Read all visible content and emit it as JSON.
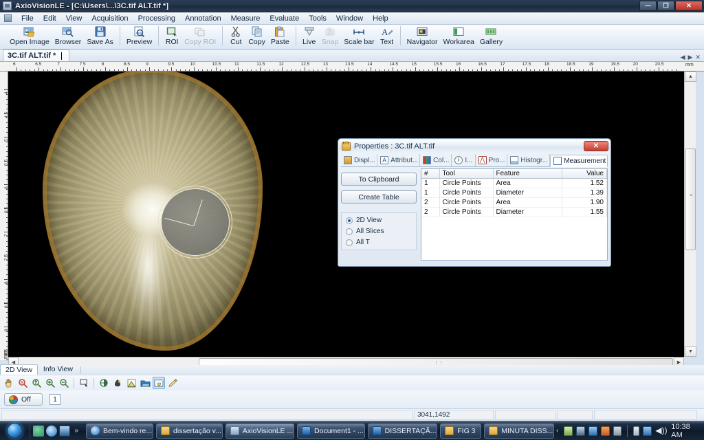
{
  "window": {
    "title": "AxioVisionLE - [C:\\Users\\...\\3C.tif ALT.tif *]",
    "minimize_label": "—",
    "restore_label": "❐",
    "close_label": "✕"
  },
  "menubar": {
    "items": [
      {
        "label": "File"
      },
      {
        "label": "Edit"
      },
      {
        "label": "View"
      },
      {
        "label": "Acquisition"
      },
      {
        "label": "Processing"
      },
      {
        "label": "Annotation"
      },
      {
        "label": "Measure"
      },
      {
        "label": "Evaluate"
      },
      {
        "label": "Tools"
      },
      {
        "label": "Window"
      },
      {
        "label": "Help"
      }
    ]
  },
  "toolbar": {
    "items": [
      {
        "label": "Open Image",
        "icon": "open-image-icon",
        "disabled": false
      },
      {
        "label": "Browser",
        "icon": "browser-icon",
        "disabled": false
      },
      {
        "label": "Save As",
        "icon": "save-as-icon",
        "disabled": false
      },
      {
        "label": "Preview",
        "icon": "preview-icon",
        "disabled": false
      },
      {
        "label": "ROI",
        "icon": "roi-icon",
        "disabled": false
      },
      {
        "label": "Copy ROI",
        "icon": "copy-roi-icon",
        "disabled": true
      },
      {
        "label": "Cut",
        "icon": "cut-icon",
        "disabled": false
      },
      {
        "label": "Copy",
        "icon": "copy-icon",
        "disabled": false
      },
      {
        "label": "Paste",
        "icon": "paste-icon",
        "disabled": false
      },
      {
        "label": "Live",
        "icon": "live-icon",
        "disabled": false
      },
      {
        "label": "Snap",
        "icon": "snap-icon",
        "disabled": true
      },
      {
        "label": "Scale bar",
        "icon": "scale-bar-icon",
        "disabled": false
      },
      {
        "label": "Text",
        "icon": "text-icon",
        "disabled": false
      },
      {
        "label": "Navigator",
        "icon": "navigator-icon",
        "disabled": false
      },
      {
        "label": "Workarea",
        "icon": "workarea-icon",
        "disabled": false
      },
      {
        "label": "Gallery",
        "icon": "gallery-icon",
        "disabled": false
      }
    ]
  },
  "document_tab": {
    "label": "3C.tif ALT.tif *",
    "nav_prev": "◀",
    "nav_next": "▶",
    "close": "✕"
  },
  "rulers": {
    "unit": "mm",
    "horizontal_labels": [
      "6",
      "6.5",
      "7",
      "7.5",
      "8",
      "8.5",
      "9",
      "9.5",
      "10",
      "10.5",
      "11",
      "11.5",
      "12",
      "12.5",
      "13",
      "13.5",
      "14",
      "14.5",
      "15",
      "15.5",
      "16",
      "16.5",
      "17",
      "17.5",
      "18",
      "18.5",
      "19",
      "19.5",
      "20",
      "20.5"
    ],
    "vertical_labels": [
      "4",
      "4.5",
      "5",
      "5.5",
      "6",
      "6.5",
      "7",
      "7.5",
      "8",
      "8.5",
      "9",
      "9.5"
    ]
  },
  "dialog": {
    "title": "Properties : 3C.tif ALT.tif",
    "close_label": "✕",
    "tabs": [
      {
        "label": "Displ...",
        "icon": "display-icon",
        "active": false
      },
      {
        "label": "Attribut...",
        "icon": "attributes-icon",
        "active": false
      },
      {
        "label": "Col...",
        "icon": "colors-icon",
        "active": false
      },
      {
        "label": "I...",
        "icon": "info-icon",
        "active": false
      },
      {
        "label": "Pro...",
        "icon": "profile-icon",
        "active": false
      },
      {
        "label": "Histogr...",
        "icon": "histogram-icon",
        "active": false
      },
      {
        "label": "Measurement",
        "icon": "measurement-icon",
        "active": true
      }
    ],
    "buttons": [
      {
        "label": "To Clipboard"
      },
      {
        "label": "Create Table"
      }
    ],
    "scope_options": [
      {
        "label": "2D View",
        "selected": true
      },
      {
        "label": "All Slices",
        "selected": false
      },
      {
        "label": "All T",
        "selected": false
      }
    ],
    "table": {
      "columns": [
        "#",
        "Tool",
        "Feature",
        "Value"
      ],
      "rows": [
        [
          "1",
          "Circle Points",
          "Area",
          "1.52"
        ],
        [
          "1",
          "Circle Points",
          "Diameter",
          "1.39"
        ],
        [
          "2",
          "Circle Points",
          "Area",
          "1.90"
        ],
        [
          "2",
          "Circle Points",
          "Diameter",
          "1.55"
        ]
      ]
    }
  },
  "view_tabs": [
    {
      "label": "2D View",
      "active": true
    },
    {
      "label": "Info View",
      "active": false
    }
  ],
  "low_tools": [
    {
      "icon": "pan-hand-icon",
      "selected": false
    },
    {
      "icon": "zoom-fit-icon",
      "selected": false
    },
    {
      "icon": "zoom-100-icon",
      "selected": false
    },
    {
      "icon": "zoom-in-icon",
      "selected": false
    },
    {
      "icon": "zoom-out-icon",
      "selected": false
    },
    {
      "icon": "select-rect-icon",
      "selected": false
    },
    {
      "icon": "contrast-icon",
      "selected": false
    },
    {
      "icon": "gamma-icon",
      "selected": false
    },
    {
      "icon": "curve-icon",
      "selected": false
    },
    {
      "icon": "folder-open-icon",
      "selected": false
    },
    {
      "icon": "window-image-icon",
      "selected": true
    },
    {
      "icon": "pencil-icon",
      "selected": false
    }
  ],
  "channel_bar": {
    "toggle_label": "Off",
    "channel_number": "1"
  },
  "status_bar": {
    "coordinates": "3041,1492"
  },
  "taskbar": {
    "quick_launch": [
      {
        "icon": "show-desktop-users-icon"
      },
      {
        "icon": "internet-explorer-icon"
      },
      {
        "icon": "show-desktop-icon"
      }
    ],
    "overflow_label": "»",
    "buttons": [
      {
        "label": "Bem-vindo re...",
        "icon": "ie-icon",
        "active": false
      },
      {
        "label": "dissertação v...",
        "icon": "folder-icon",
        "active": false
      },
      {
        "label": "AxioVisionLE ...",
        "icon": "axiovision-icon",
        "active": true
      },
      {
        "label": "Document1 - ...",
        "icon": "word-icon",
        "active": false
      },
      {
        "label": "DISSERTAÇÃ...",
        "icon": "word-icon",
        "active": false
      },
      {
        "label": "FIG 3",
        "icon": "folder-icon",
        "active": false
      },
      {
        "label": "MINUTA DISS...",
        "icon": "folder-icon",
        "active": false
      }
    ],
    "tray_chevron": "‹",
    "tray_icons": [
      {
        "icon": "antivirus-icon"
      },
      {
        "icon": "network-connection-icon"
      },
      {
        "icon": "display-settings-icon"
      },
      {
        "icon": "update-icon"
      },
      {
        "icon": "monitor-icon"
      },
      {
        "icon": "battery-icon"
      },
      {
        "icon": "network-icon"
      },
      {
        "icon": "volume-icon"
      }
    ],
    "clock": "10:38 AM"
  },
  "image_view": {
    "measurement_circles": 2,
    "background_color": "#000000"
  }
}
